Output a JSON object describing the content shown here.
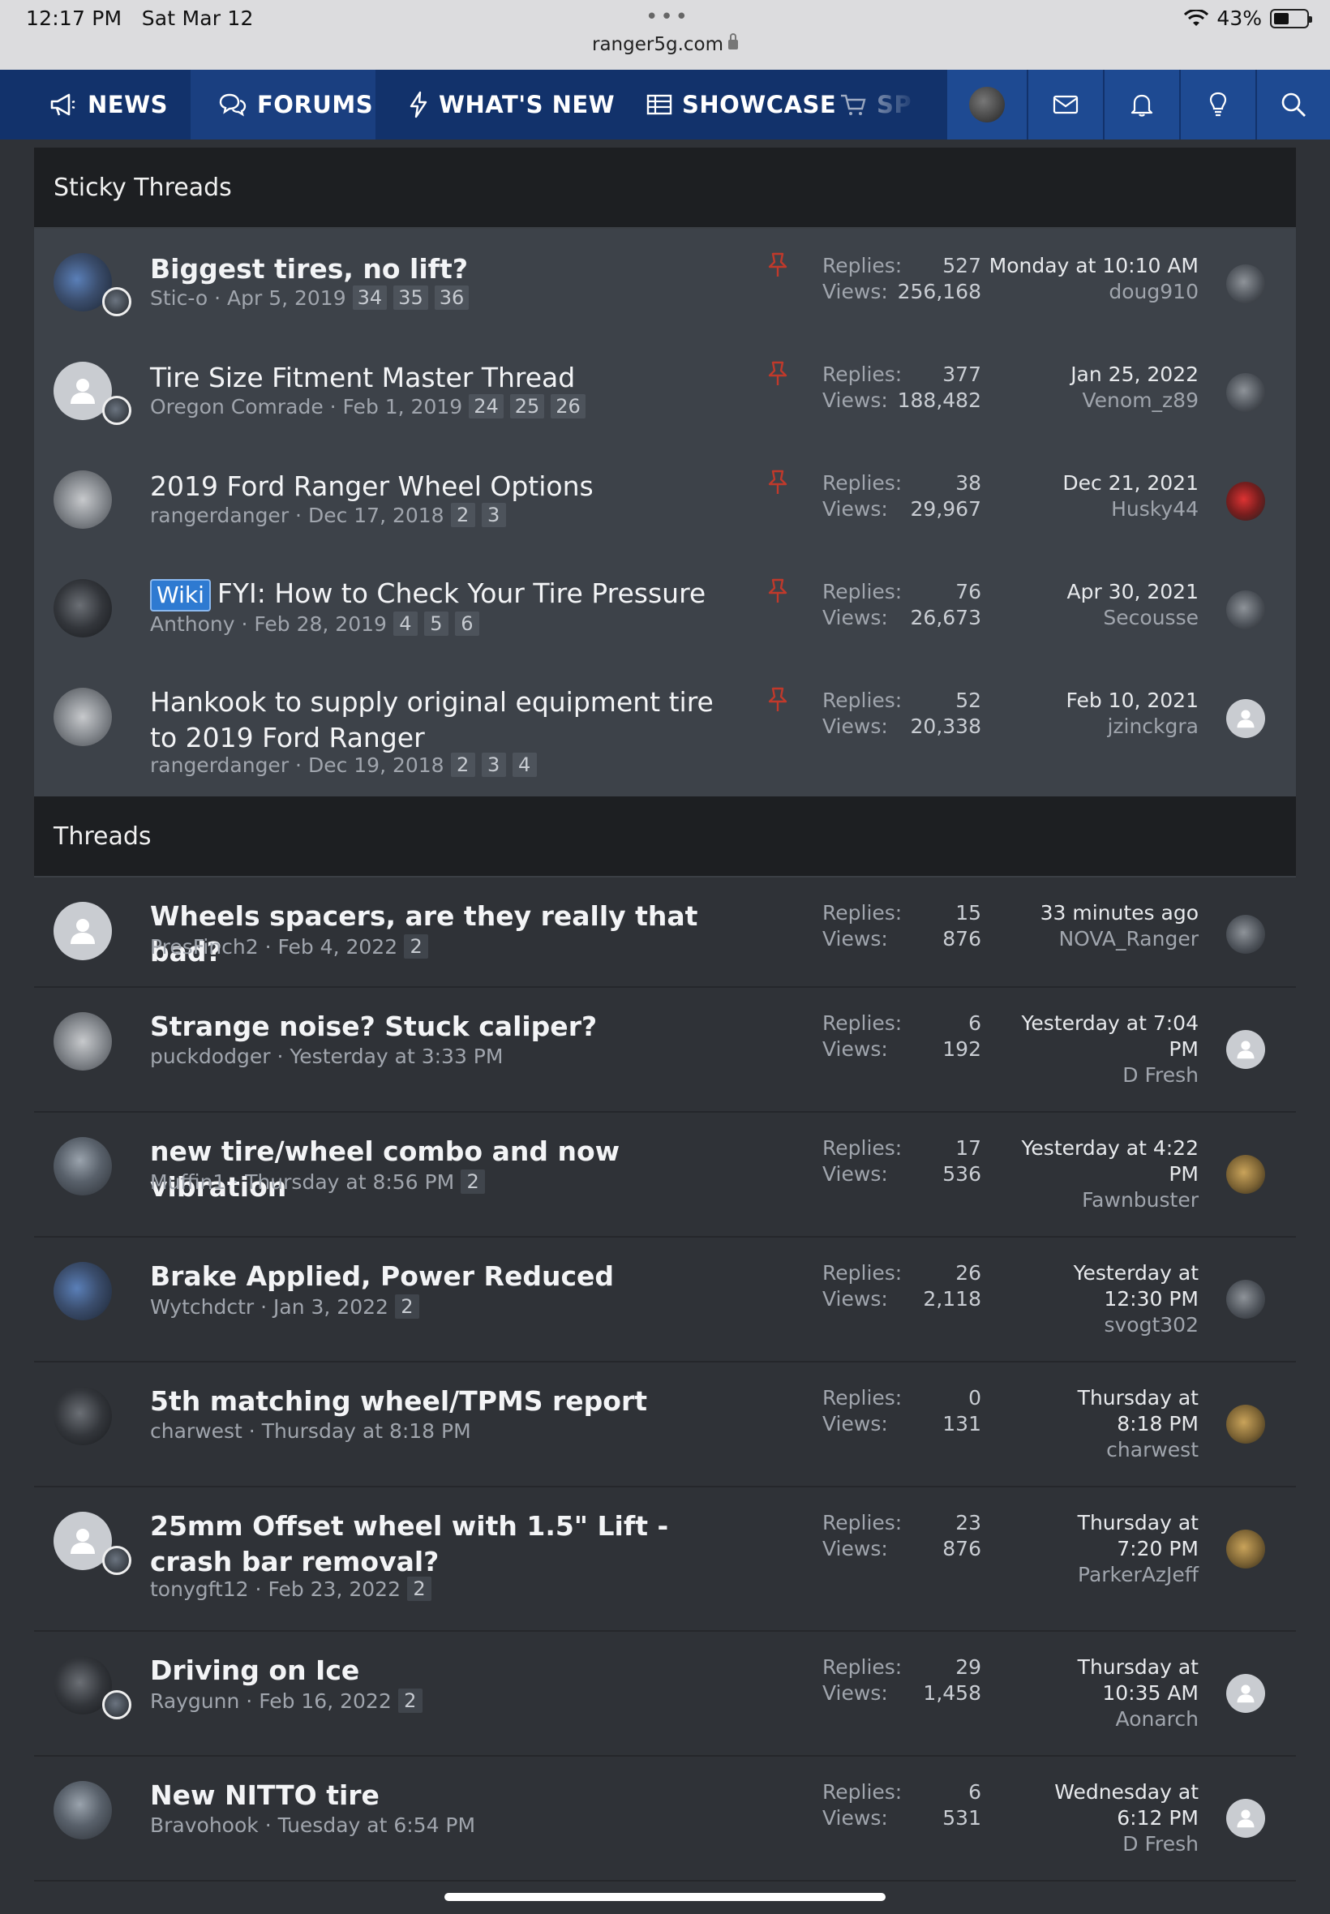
{
  "status": {
    "time": "12:17 PM",
    "date": "Sat Mar 12",
    "battery": "43%",
    "battery_level": 0.43,
    "url": "ranger5g.com"
  },
  "nav": {
    "tabs": [
      {
        "label": "NEWS",
        "icon": "megaphone-icon"
      },
      {
        "label": "FORUMS",
        "icon": "chat-bubbles-icon"
      },
      {
        "label": "WHAT'S NEW",
        "icon": "lightning-icon"
      },
      {
        "label": "SHOWCASE",
        "icon": "table-icon"
      }
    ],
    "partial_tab": "SP",
    "right": [
      "avatar",
      "envelope-icon",
      "bell-icon",
      "lightbulb-icon",
      "search-icon"
    ]
  },
  "sticky": {
    "heading": "Sticky Threads",
    "rows": [
      {
        "title": "Biggest tires, no lift?",
        "author": "Stic-o",
        "date": "Apr 5, 2019",
        "pages": [
          "34",
          "35",
          "36"
        ],
        "replies": "527",
        "views": "256,168",
        "last_date": "Monday at 10:10 AM",
        "last_user": "doug910"
      },
      {
        "title": "Tire Size Fitment Master Thread",
        "author": "Oregon Comrade",
        "date": "Feb 1, 2019",
        "pages": [
          "24",
          "25",
          "26"
        ],
        "replies": "377",
        "views": "188,482",
        "last_date": "Jan 25, 2022",
        "last_user": "Venom_z89"
      },
      {
        "title": "2019 Ford Ranger Wheel Options",
        "author": "rangerdanger",
        "date": "Dec 17, 2018",
        "pages": [
          "2",
          "3"
        ],
        "replies": "38",
        "views": "29,967",
        "last_date": "Dec 21, 2021",
        "last_user": "Husky44"
      },
      {
        "title": "FYI: How to Check Your Tire Pressure",
        "prefix": "Wiki",
        "author": "Anthony",
        "date": "Feb 28, 2019",
        "pages": [
          "4",
          "5",
          "6"
        ],
        "replies": "76",
        "views": "26,673",
        "last_date": "Apr 30, 2021",
        "last_user": "Secousse"
      },
      {
        "title": "Hankook to supply original equipment tire to 2019 Ford Ranger",
        "author": "rangerdanger",
        "date": "Dec 19, 2018",
        "pages": [
          "2",
          "3",
          "4"
        ],
        "replies": "52",
        "views": "20,338",
        "last_date": "Feb 10, 2021",
        "last_user": "jzinckgra"
      }
    ]
  },
  "threads": {
    "heading": "Threads",
    "replies_label": "Replies:",
    "views_label": "Views:",
    "rows": [
      {
        "title": "Wheels spacers, are they really that bad?",
        "author": "PresFinch2",
        "date": "Feb 4, 2022",
        "pages": [
          "2"
        ],
        "replies": "15",
        "views": "876",
        "last_date": "33 minutes ago",
        "last_user": "NOVA_Ranger"
      },
      {
        "title": "Strange noise? Stuck caliper?",
        "author": "puckdodger",
        "date": "Yesterday at 3:33 PM",
        "pages": [],
        "replies": "6",
        "views": "192",
        "last_date": "Yesterday at 7:04 PM",
        "last_user": "D Fresh"
      },
      {
        "title": "new tire/wheel combo and now vibration",
        "author": "Muffin1",
        "date": "Thursday at 8:56 PM",
        "pages": [
          "2"
        ],
        "replies": "17",
        "views": "536",
        "last_date": "Yesterday at 4:22 PM",
        "last_user": "Fawnbuster"
      },
      {
        "title": "Brake Applied, Power Reduced",
        "author": "Wytchdctr",
        "date": "Jan 3, 2022",
        "pages": [
          "2"
        ],
        "replies": "26",
        "views": "2,118",
        "last_date": "Yesterday at 12:30 PM",
        "last_user": "svogt302"
      },
      {
        "title": "5th matching wheel/TPMS report",
        "author": "charwest",
        "date": "Thursday at 8:18 PM",
        "pages": [],
        "replies": "0",
        "views": "131",
        "last_date": "Thursday at 8:18 PM",
        "last_user": "charwest"
      },
      {
        "title": "25mm Offset wheel with 1.5\" Lift - crash bar removal?",
        "author": "tonygft12",
        "date": "Feb 23, 2022",
        "pages": [
          "2"
        ],
        "replies": "23",
        "views": "876",
        "last_date": "Thursday at 7:20 PM",
        "last_user": "ParkerAzJeff"
      },
      {
        "title": "Driving on Ice",
        "author": "Raygunn",
        "date": "Feb 16, 2022",
        "pages": [
          "2"
        ],
        "replies": "29",
        "views": "1,458",
        "last_date": "Thursday at 10:35 AM",
        "last_user": "Aonarch"
      },
      {
        "title": "New NITTO tire",
        "author": "Bravohook",
        "date": "Tuesday at 6:54 PM",
        "pages": [],
        "replies": "6",
        "views": "531",
        "last_date": "Wednesday at 6:12 PM",
        "last_user": "D Fresh"
      }
    ]
  },
  "colors": {
    "nav_bg": "#12326b",
    "nav_active": "#1a3f80",
    "sticky_bg": "#3d4249",
    "thread_bg": "#2f3237",
    "header_bg": "#1d1f22",
    "pin": "#c0392b",
    "wiki": "#2e7ad1"
  }
}
